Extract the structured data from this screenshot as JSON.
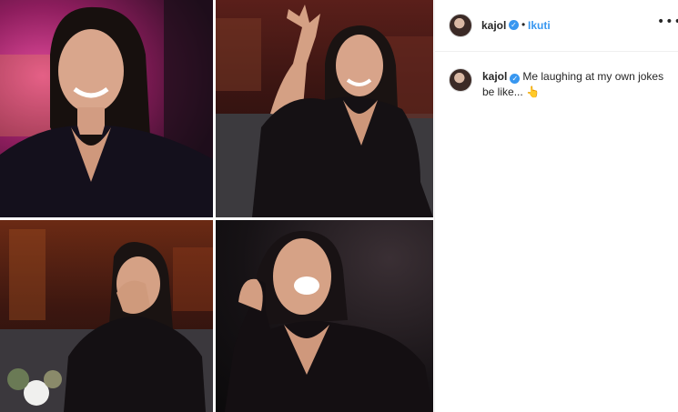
{
  "post": {
    "username": "kajol",
    "location": "Ikuti",
    "separator": "•",
    "verified_icon": "verified-badge-icon",
    "more_icon": "more-options-icon"
  },
  "caption": {
    "username": "kajol",
    "text": "Me laughing at my own jokes be like...",
    "emoji": "👆"
  },
  "photos": [
    {
      "name": "smiling-portrait"
    },
    {
      "name": "hand-raised-laugh"
    },
    {
      "name": "covering-face-laugh"
    },
    {
      "name": "fist-pump-laugh"
    }
  ],
  "colors": {
    "accent": "#3897f0",
    "text": "#262626",
    "border": "#efefef"
  }
}
